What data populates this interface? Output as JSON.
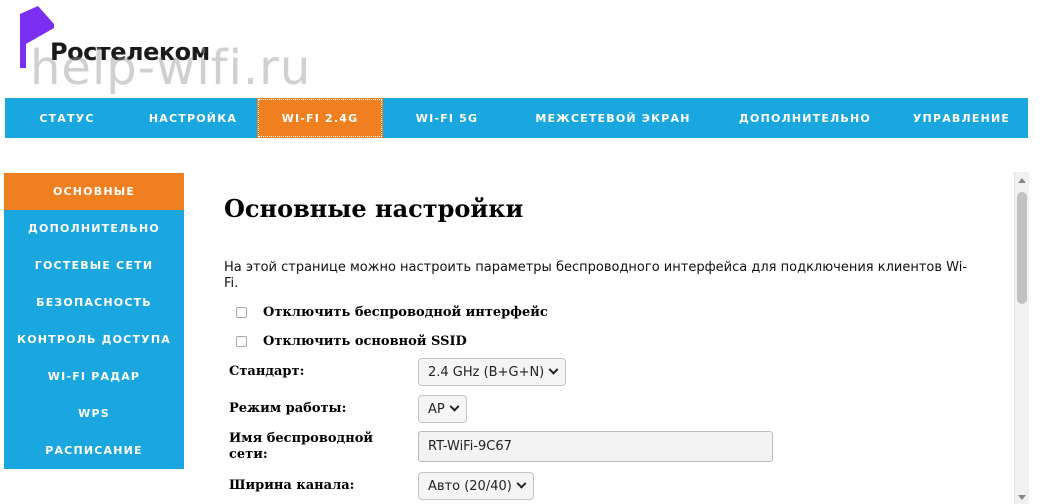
{
  "brand": {
    "logo_text": "Ростелеком",
    "logo_color": "#7b2ff2",
    "watermark": "help-wifi.ru"
  },
  "topnav": {
    "tabs": [
      {
        "label": "СТАТУС"
      },
      {
        "label": "НАСТРОЙКА"
      },
      {
        "label": "WI-FI 2.4G",
        "active": true
      },
      {
        "label": "WI-FI 5G"
      },
      {
        "label": "МЕЖСЕТЕВОЙ ЭКРАН"
      },
      {
        "label": "ДОПОЛНИТЕЛЬНО"
      },
      {
        "label": "УПРАВЛЕНИЕ"
      }
    ]
  },
  "sidebar": {
    "items": [
      {
        "label": "ОСНОВНЫЕ",
        "active": true
      },
      {
        "label": "ДОПОЛНИТЕЛЬНО"
      },
      {
        "label": "ГОСТЕВЫЕ СЕТИ"
      },
      {
        "label": "БЕЗОПАСНОСТЬ"
      },
      {
        "label": "КОНТРОЛЬ ДОСТУПА"
      },
      {
        "label": "WI-FI РАДАР"
      },
      {
        "label": "WPS"
      },
      {
        "label": "РАСПИСАНИЕ"
      }
    ]
  },
  "main": {
    "title": "Основные настройки",
    "description": "На этой странице можно настроить параметры беспроводного интерфейса для подключения клиентов Wi-Fi.",
    "checkboxes": [
      {
        "label": "Отключить беспроводной интерфейс",
        "checked": false
      },
      {
        "label": "Отключить основной SSID",
        "checked": false
      }
    ],
    "fields": {
      "standard": {
        "label": "Стандарт:",
        "value": "2.4 GHz (B+G+N)"
      },
      "mode": {
        "label": "Режим работы:",
        "value": "AP"
      },
      "ssid": {
        "label": "Имя беспроводной сети:",
        "value": "RT-WiFi-9C67"
      },
      "bandwidth": {
        "label": "Ширина канала:",
        "value": "Авто (20/40)"
      }
    }
  },
  "colors": {
    "nav_blue": "#1aa7e0",
    "active_orange": "#f07f20"
  }
}
